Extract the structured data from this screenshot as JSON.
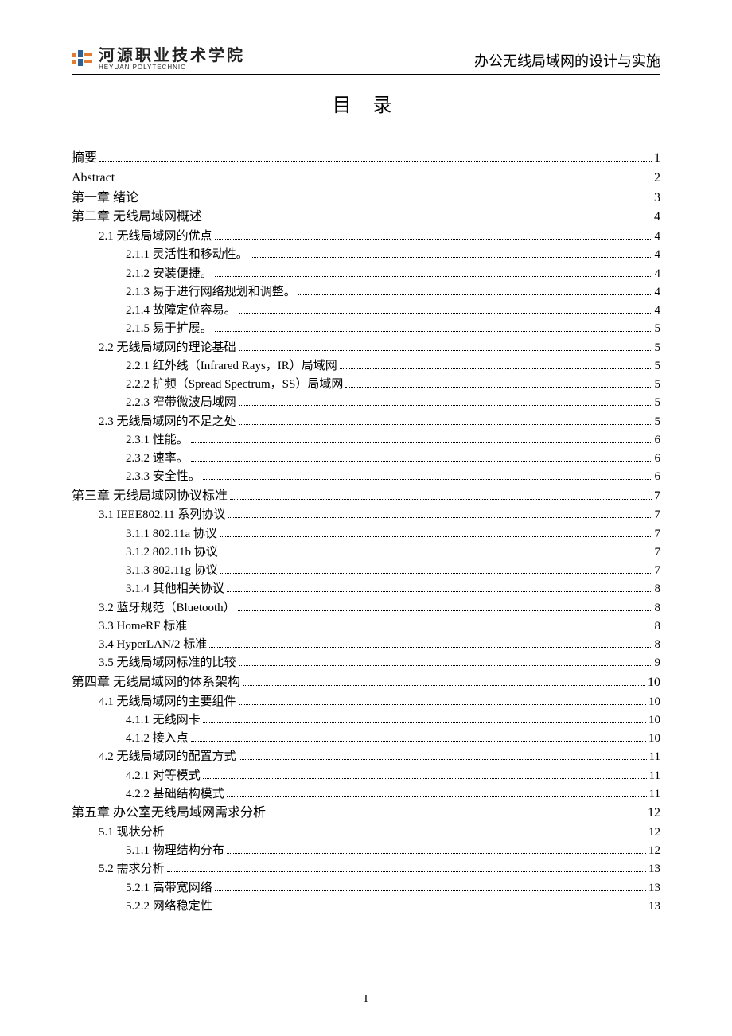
{
  "header": {
    "logo_cn": "河源职业技术学院",
    "logo_en": "HEYUAN  POLYTECHNIC",
    "doc_title": "办公无线局域网的设计与实施"
  },
  "title": "目 录",
  "page_number": "I",
  "toc": [
    {
      "level": 0,
      "label": "摘要",
      "page": "1"
    },
    {
      "level": 0,
      "label": "Abstract",
      "page": "2"
    },
    {
      "level": 0,
      "label": "第一章  绪论",
      "page": "3"
    },
    {
      "level": 0,
      "label": "第二章  无线局域网概述",
      "page": "4"
    },
    {
      "level": 1,
      "label": "2.1 无线局域网的优点",
      "page": "4"
    },
    {
      "level": 2,
      "label": "2.1.1  灵活性和移动性。",
      "page": "4"
    },
    {
      "level": 2,
      "label": "2.1.2  安装便捷。",
      "page": "4"
    },
    {
      "level": 2,
      "label": "2.1.3  易于进行网络规划和调整。",
      "page": "4"
    },
    {
      "level": 2,
      "label": "2.1.4  故障定位容易。",
      "page": "4"
    },
    {
      "level": 2,
      "label": "2.1.5  易于扩展。",
      "page": "5"
    },
    {
      "level": 1,
      "label": "2.2 无线局域网的理论基础",
      "page": "5"
    },
    {
      "level": 2,
      "label": "2.2.1  红外线（Infrared Rays，IR）局域网",
      "page": "5"
    },
    {
      "level": 2,
      "label": "2.2.2  扩频（Spread Spectrum，SS）局域网",
      "page": "5"
    },
    {
      "level": 2,
      "label": "2.2.3  窄带微波局域网",
      "page": "5"
    },
    {
      "level": 1,
      "label": "2.3 无线局域网的不足之处",
      "page": "5"
    },
    {
      "level": 2,
      "label": "2.3.1  性能。",
      "page": "6"
    },
    {
      "level": 2,
      "label": "2.3.2  速率。",
      "page": "6"
    },
    {
      "level": 2,
      "label": "2.3.3  安全性。",
      "page": "6"
    },
    {
      "level": 0,
      "label": "第三章  无线局域网协议标准",
      "page": "7"
    },
    {
      "level": 1,
      "label": "3.1 IEEE802.11 系列协议",
      "page": "7"
    },
    {
      "level": 2,
      "label": "3.1.1 802.11a 协议",
      "page": "7"
    },
    {
      "level": 2,
      "label": "3.1.2 802.11b 协议",
      "page": "7"
    },
    {
      "level": 2,
      "label": "3.1.3 802.11g 协议",
      "page": "7"
    },
    {
      "level": 2,
      "label": "3.1.4  其他相关协议",
      "page": "8"
    },
    {
      "level": 1,
      "label": "3.2  蓝牙规范（Bluetooth）",
      "page": "8"
    },
    {
      "level": 1,
      "label": "3.3 HomeRF 标准",
      "page": "8"
    },
    {
      "level": 1,
      "label": "3.4 HyperLAN/2 标准",
      "page": "8"
    },
    {
      "level": 1,
      "label": "3.5  无线局域网标准的比较",
      "page": "9"
    },
    {
      "level": 0,
      "label": "第四章  无线局域网的体系架构",
      "page": "10"
    },
    {
      "level": 1,
      "label": "4.1  无线局域网的主要组件",
      "page": "10"
    },
    {
      "level": 2,
      "label": "4.1.1  无线网卡",
      "page": "10"
    },
    {
      "level": 2,
      "label": "4.1.2  接入点",
      "page": "10"
    },
    {
      "level": 1,
      "label": "4.2 无线局域网的配置方式",
      "page": "11"
    },
    {
      "level": 2,
      "label": "4.2.1  对等模式",
      "page": "11"
    },
    {
      "level": 2,
      "label": "4.2.2  基础结构模式",
      "page": "11"
    },
    {
      "level": 0,
      "label": "第五章  办公室无线局域网需求分析",
      "page": "12"
    },
    {
      "level": 1,
      "label": "5.1  现状分析",
      "page": "12"
    },
    {
      "level": 2,
      "label": "5.1.1  物理结构分布",
      "page": "12"
    },
    {
      "level": 1,
      "label": "5.2  需求分析",
      "page": "13"
    },
    {
      "level": 2,
      "label": "5.2.1  高带宽网络",
      "page": "13"
    },
    {
      "level": 2,
      "label": "5.2.2  网络稳定性",
      "page": "13"
    }
  ]
}
